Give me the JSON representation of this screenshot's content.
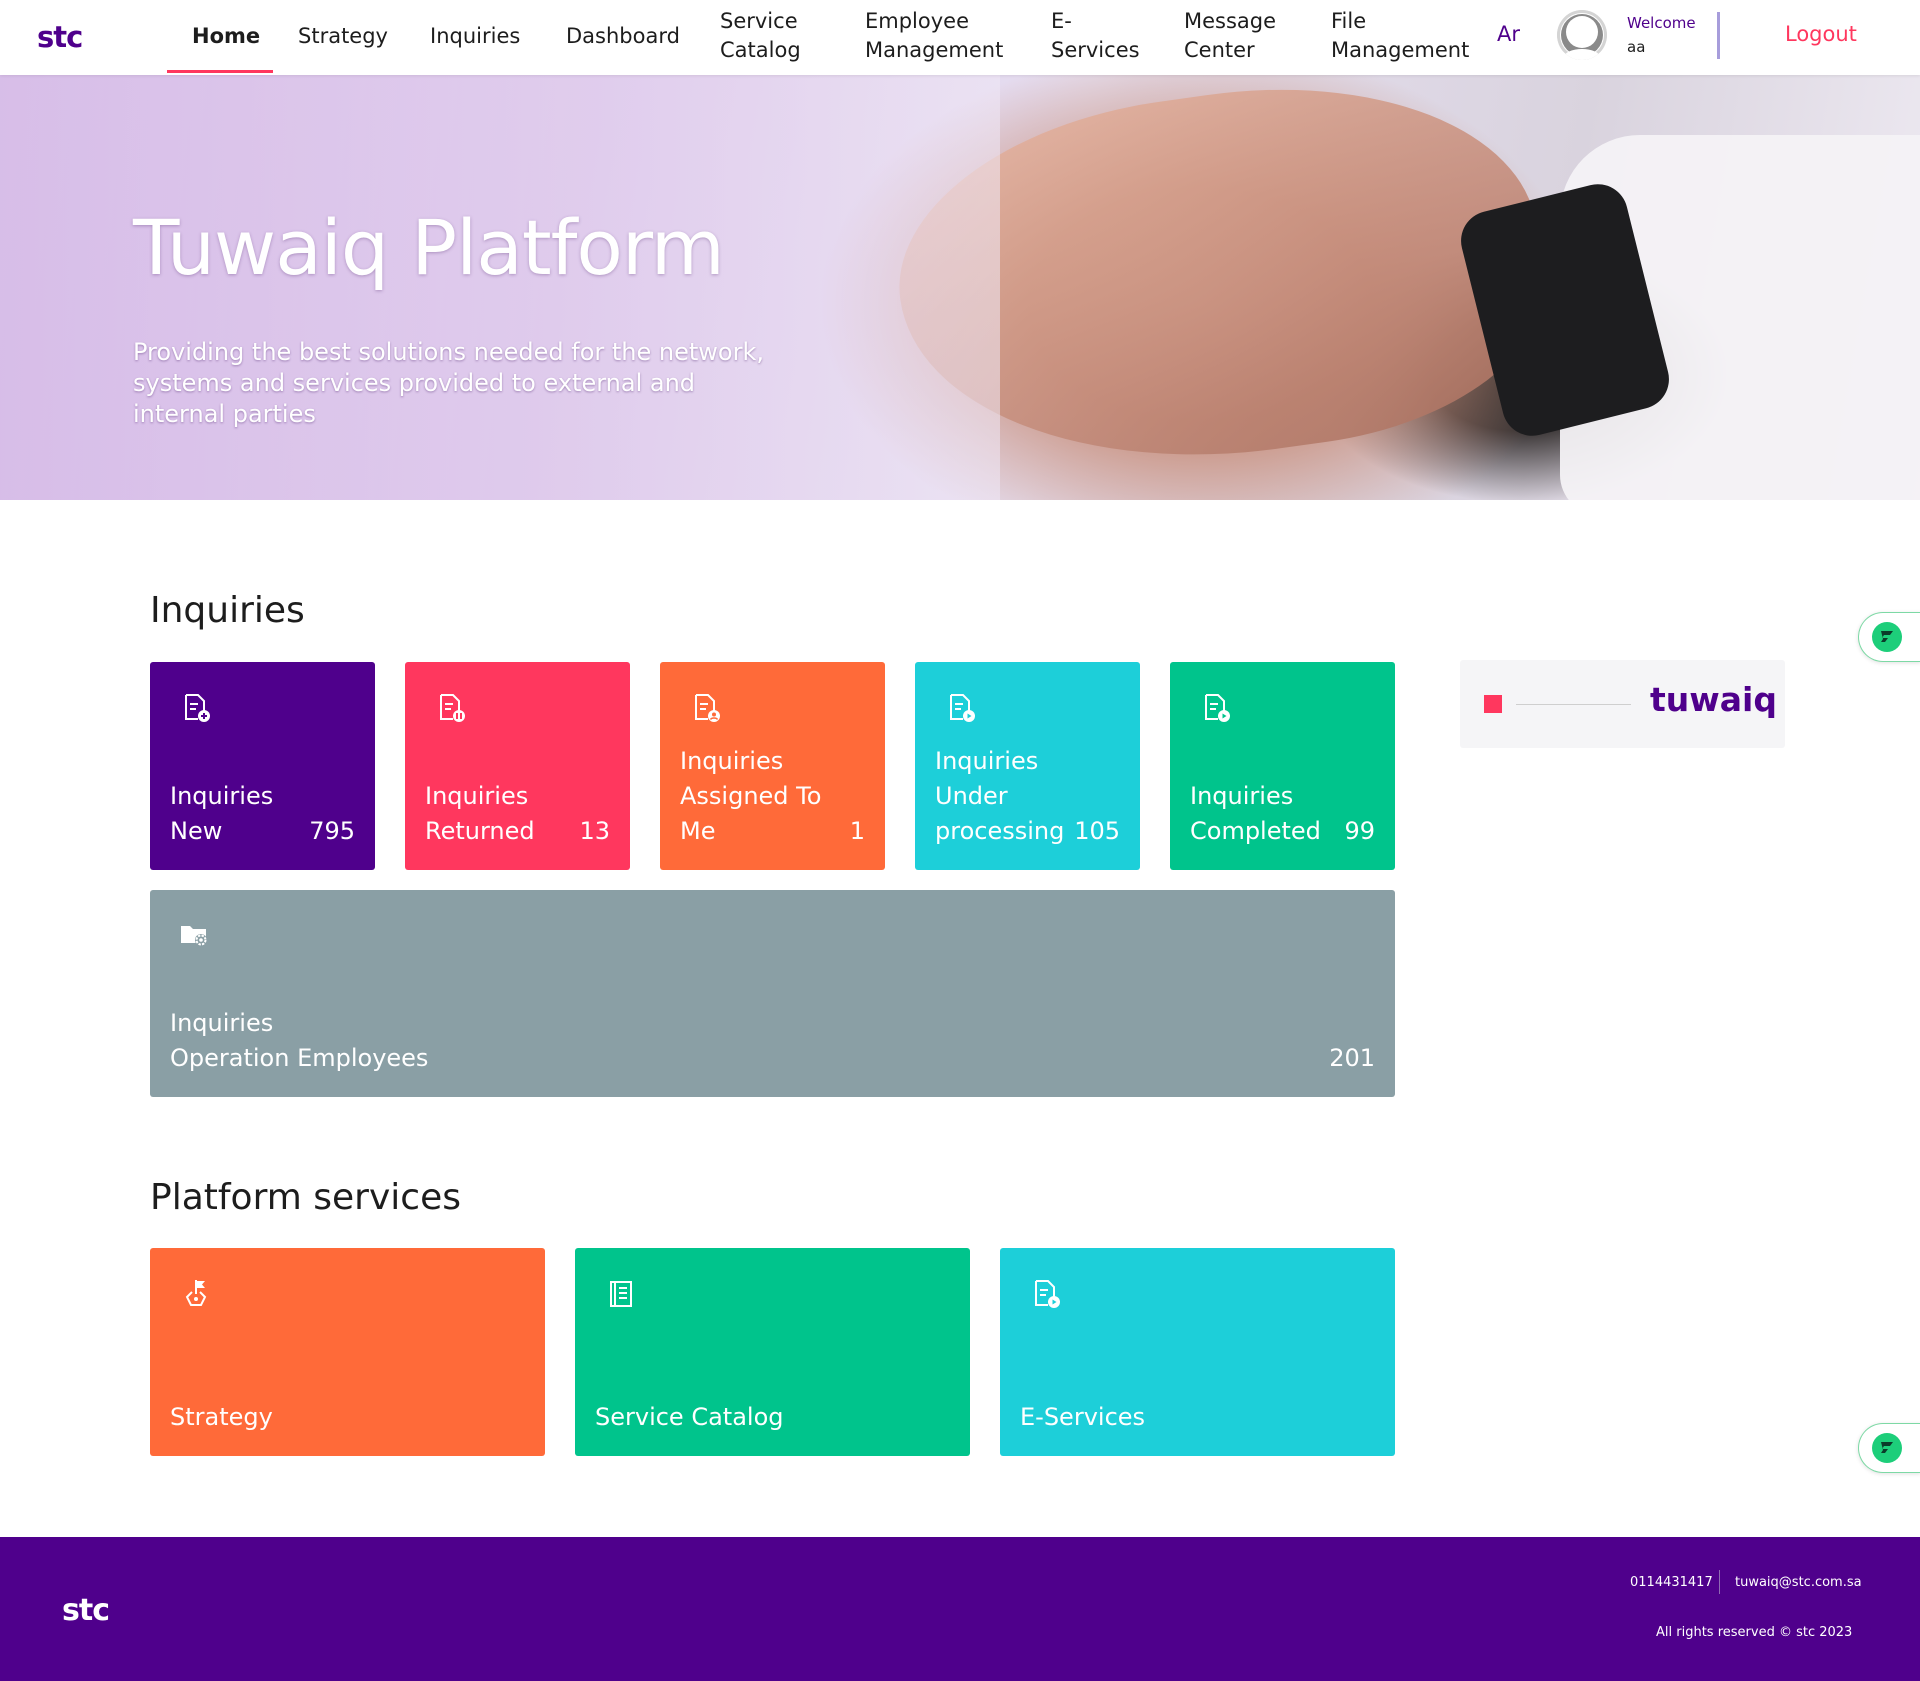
{
  "nav": {
    "logo": "stc",
    "items": [
      {
        "label": "Home"
      },
      {
        "label": "Strategy"
      },
      {
        "label": "Inquiries"
      },
      {
        "label": "Dashboard"
      },
      {
        "label1": "Service",
        "label2": "Catalog"
      },
      {
        "label1": "Employee",
        "label2": "Management"
      },
      {
        "label1": "E-",
        "label2": "Services"
      },
      {
        "label1": "Message",
        "label2": "Center"
      },
      {
        "label1": "File",
        "label2": "Management"
      }
    ],
    "lang": "Ar",
    "welcome": "Welcome",
    "user": "aa",
    "logout": "Logout"
  },
  "hero": {
    "title": "Tuwaiq Platform",
    "subtitle": "Providing the best solutions needed for the network, systems and services provided to external and internal parties"
  },
  "inquiries": {
    "title": "Inquiries",
    "tiles": [
      {
        "line1": "Inquiries",
        "line2": "New",
        "count": "795",
        "color": "#4f008c",
        "icon": "document-add-icon"
      },
      {
        "line1": "Inquiries",
        "line2": "Returned",
        "count": "13",
        "color": "#ff375e",
        "icon": "document-pause-icon"
      },
      {
        "line1": "Inquiries",
        "line2": "Assigned To",
        "line3": "Me",
        "count": "1",
        "color": "#ff6a39",
        "icon": "document-user-icon"
      },
      {
        "line1": "Inquiries",
        "line2": "Under",
        "line3": "processing",
        "count": "105",
        "color": "#1dcfd9",
        "icon": "document-play-icon"
      },
      {
        "line1": "Inquiries",
        "line2": "Completed",
        "count": "99",
        "color": "#00c48c",
        "icon": "document-play-icon"
      }
    ],
    "wide": {
      "line1": "Inquiries",
      "line2": "Operation Employees",
      "count": "201",
      "color": "#8a9fa5",
      "icon": "folder-gear-icon"
    }
  },
  "side": {
    "brand": "tuwaiq"
  },
  "services": {
    "title": "Platform services",
    "tiles": [
      {
        "label": "Strategy",
        "color": "#ff6a39",
        "icon": "flag-icon"
      },
      {
        "label": "Service Catalog",
        "color": "#00c48c",
        "icon": "catalog-book-icon"
      },
      {
        "label": "E-Services",
        "color": "#1dcfd9",
        "icon": "document-play-icon"
      }
    ]
  },
  "footer": {
    "logo": "stc",
    "phone": "0114431417",
    "email": "tuwaiq@stc.com.sa",
    "rights": "All rights reserved © stc 2023"
  }
}
